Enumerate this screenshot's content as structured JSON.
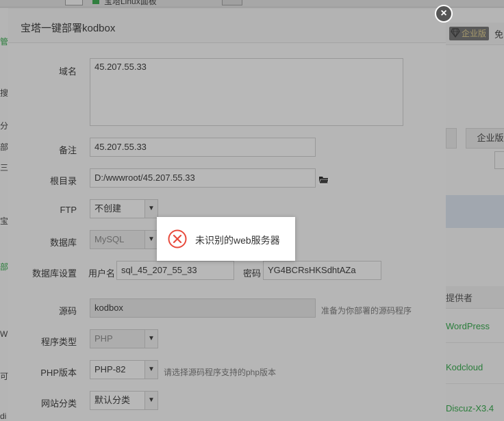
{
  "background": {
    "tab_title": "宝塔Linux面板",
    "left_fragments": [
      "管",
      "搜索",
      "分类",
      "部",
      "三",
      "宝",
      "部",
      "W",
      "可",
      "di"
    ],
    "enterprise_badge": "企业版",
    "free_label": "免",
    "enterprise_button": "企业版",
    "table_header_provider": "提供者",
    "table_rows": [
      "WordPress",
      "Kodcloud",
      "Discuz-X3.4"
    ]
  },
  "dialog": {
    "title": "宝塔一键部署kodbox",
    "close_label": "×",
    "fields": {
      "domain": {
        "label": "域名",
        "value": "45.207.55.33"
      },
      "remark": {
        "label": "备注",
        "value": "45.207.55.33"
      },
      "root_dir": {
        "label": "根目录",
        "value": "D:/wwwroot/45.207.55.33"
      },
      "ftp": {
        "label": "FTP",
        "value": "不创建"
      },
      "database": {
        "label": "数据库",
        "value": "MySQL"
      },
      "db_settings": {
        "label": "数据库设置",
        "username_label": "用户名",
        "username_value": "sql_45_207_55_33",
        "password_label": "密码",
        "password_value": "YG4BCRsHKSdhtAZa"
      },
      "source": {
        "label": "源码",
        "value": "kodbox",
        "hint": "准备为你部署的源码程序"
      },
      "program_type": {
        "label": "程序类型",
        "value": "PHP"
      },
      "php_version": {
        "label": "PHP版本",
        "value": "PHP-82",
        "hint": "请选择源码程序支持的php版本"
      },
      "site_category": {
        "label": "网站分类",
        "value": "默认分类"
      }
    }
  },
  "toast": {
    "message": "未识别的web服务器",
    "icon": "error-circle-icon",
    "color": "#e84a3c"
  }
}
